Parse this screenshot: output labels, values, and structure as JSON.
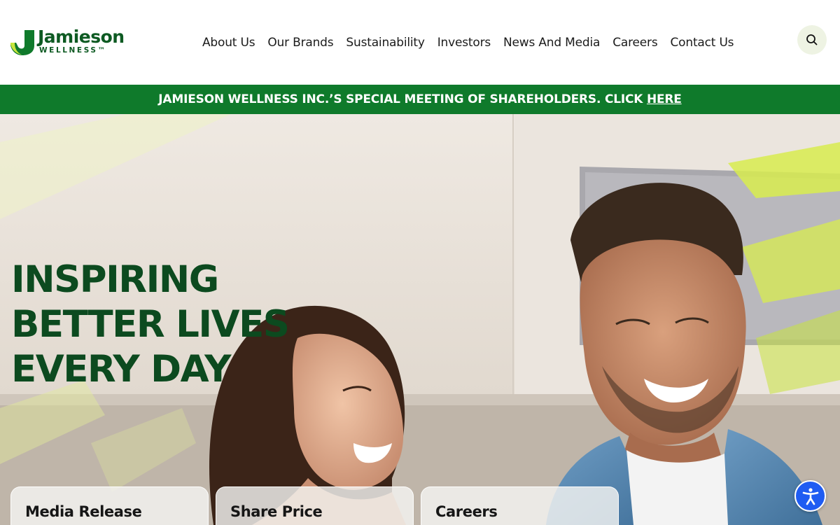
{
  "brand": {
    "name": "Jamieson",
    "tagline": "WELLNESS™",
    "primary_color": "#0f7a2b",
    "dark_green": "#0c4a1f",
    "lime": "#c8e63c"
  },
  "nav": {
    "items": [
      {
        "label": "About Us"
      },
      {
        "label": "Our Brands"
      },
      {
        "label": "Sustainability"
      },
      {
        "label": "Investors"
      },
      {
        "label": "News And Media"
      },
      {
        "label": "Careers"
      },
      {
        "label": "Contact Us"
      }
    ],
    "search_icon": "search-icon"
  },
  "announcement": {
    "text": "JAMIESON WELLNESS INC.’S SPECIAL MEETING OF SHAREHOLDERS. CLICK ",
    "link_label": "HERE"
  },
  "hero": {
    "title_lines": [
      "INSPIRING",
      "BETTER LIVES",
      "EVERY DAY"
    ]
  },
  "cards": [
    {
      "title": "Media Release"
    },
    {
      "title": "Share Price"
    },
    {
      "title": "Careers"
    }
  ],
  "accessibility": {
    "icon": "accessibility-icon",
    "color": "#1f5cf2"
  }
}
